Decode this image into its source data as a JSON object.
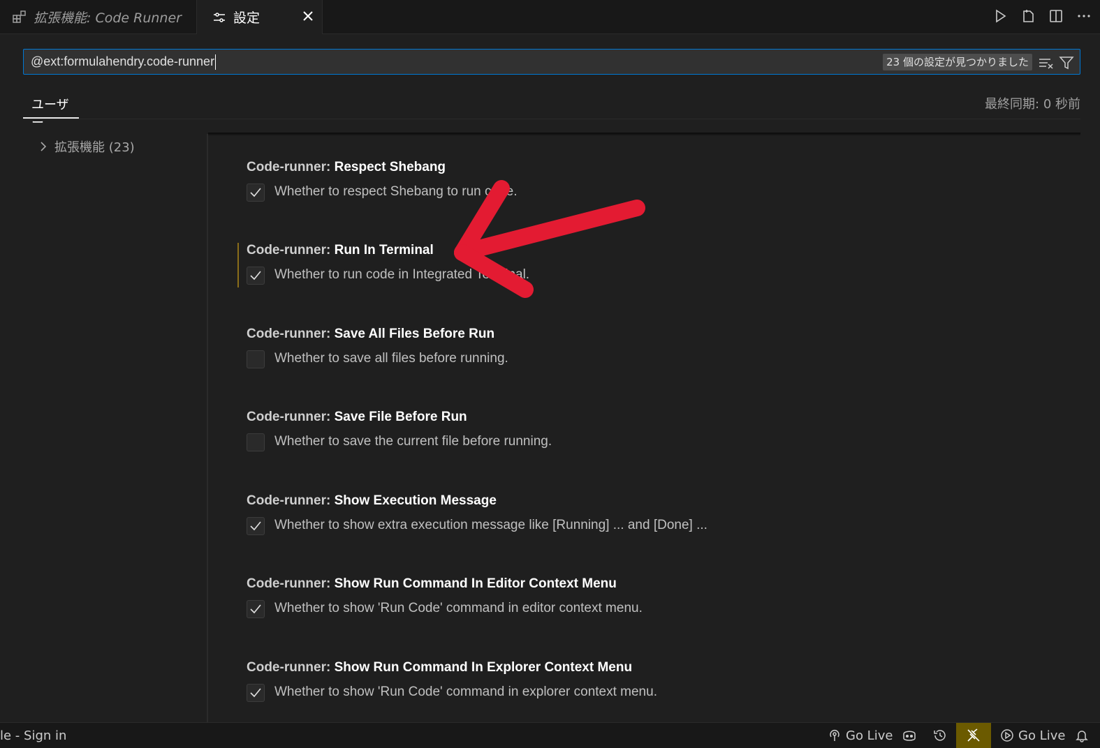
{
  "tabs": [
    {
      "label": "拡張機能: Code Runner",
      "icon": "extensions-icon",
      "active": false
    },
    {
      "label": "設定",
      "icon": "settings-sliders-icon",
      "active": true
    }
  ],
  "tab_close": "✕",
  "editor_actions": [
    "run-icon",
    "open-json-icon",
    "split-editor-icon",
    "more-icon"
  ],
  "search": {
    "value": "@ext:formulahendry.code-runner",
    "results_badge": "23 個の設定が見つかりました"
  },
  "scope": {
    "user_tab": "ユーザー",
    "last_sync": "最終同期: 0 秒前"
  },
  "toc": {
    "item": "拡張機能 (23)"
  },
  "settings": [
    {
      "category": "Code-runner: ",
      "name": "Respect Shebang",
      "description": "Whether to respect Shebang to run code.",
      "checked": true
    },
    {
      "category": "Code-runner: ",
      "name": "Run In Terminal",
      "description": "Whether to run code in Integrated Terminal.",
      "checked": true,
      "modified": true
    },
    {
      "category": "Code-runner: ",
      "name": "Save All Files Before Run",
      "description": "Whether to save all files before running.",
      "checked": false
    },
    {
      "category": "Code-runner: ",
      "name": "Save File Before Run",
      "description": "Whether to save the current file before running.",
      "checked": false
    },
    {
      "category": "Code-runner: ",
      "name": "Show Execution Message",
      "description": "Whether to show extra execution message like [Running] ... and [Done] ...",
      "checked": true
    },
    {
      "category": "Code-runner: ",
      "name": "Show Run Command In Editor Context Menu",
      "description": "Whether to show 'Run Code' command in editor context menu.",
      "checked": true
    },
    {
      "category": "Code-runner: ",
      "name": "Show Run Command In Explorer Context Menu",
      "description": "Whether to show 'Run Code' command in explorer context menu.",
      "checked": true
    }
  ],
  "statusbar": {
    "left": "le - Sign in",
    "go_live_1": "Go Live",
    "go_live_2": "Go Live"
  },
  "colors": {
    "accent": "#0078d4",
    "annotation_arrow": "#e31b32",
    "modified_marker": "#8a6d1a"
  }
}
